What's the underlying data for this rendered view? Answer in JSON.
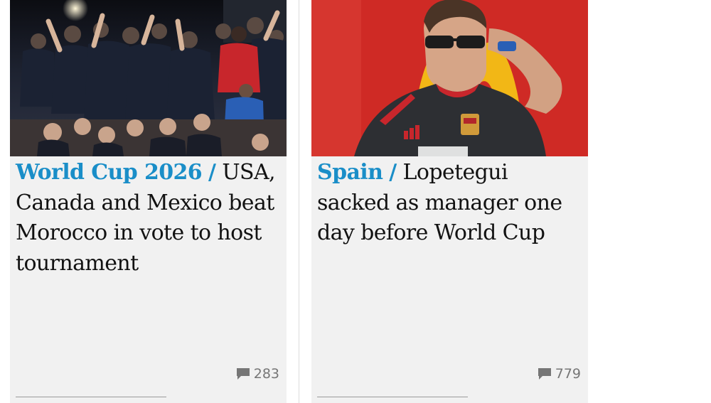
{
  "cards": [
    {
      "kicker": "World Cup 2026",
      "separator": "/",
      "headline": "USA, Canada and Mexico beat Morocco in vote to host tournament",
      "comment_count": "283",
      "comment_icon": "speech-bubble-icon",
      "image_alt": "Celebration at the World Cup 2026 hosting vote"
    },
    {
      "kicker": "Spain",
      "separator": "/",
      "headline": "Lopetegui sacked as manager one day before World Cup",
      "comment_count": "779",
      "comment_icon": "speech-bubble-icon",
      "image_alt": "Julen Lopetegui in a Spain training top"
    }
  ],
  "colors": {
    "kicker": "#1a8ec8",
    "card_background": "#f1f1f1",
    "headline_text": "#121212",
    "meta_text": "#767676"
  }
}
